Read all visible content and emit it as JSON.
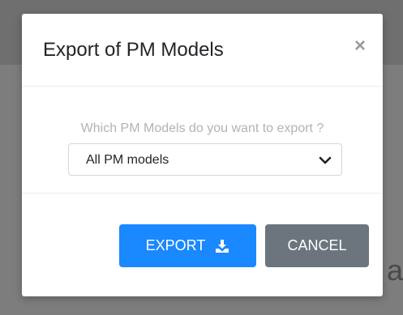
{
  "dialog": {
    "title": "Export of PM Models",
    "close_glyph": "×",
    "close_icon": "close-icon"
  },
  "body": {
    "question": "Which PM Models do you want to export ?",
    "select": {
      "selected": "All PM models",
      "icon": "chevron-down-icon"
    }
  },
  "footer": {
    "export_label": "EXPORT",
    "export_icon": "download-icon",
    "cancel_label": "CANCEL"
  },
  "background": {
    "partial_text": "a"
  },
  "colors": {
    "primary": "#1a88ff",
    "secondary": "#6c757d",
    "overlay": "#7d7d7d"
  }
}
